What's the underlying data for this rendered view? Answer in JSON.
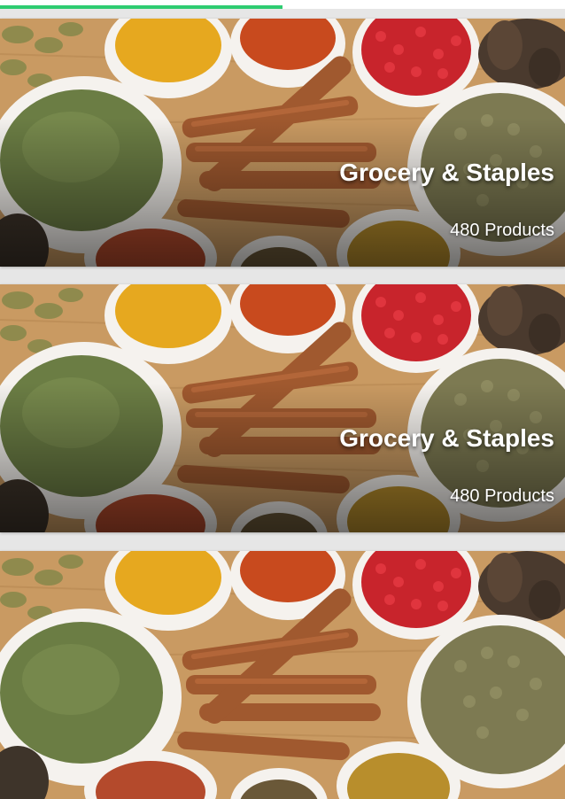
{
  "loading": {
    "progress": 0.5,
    "color": "#2ecc71"
  },
  "categories": [
    {
      "title": "Grocery & Staples",
      "count_label": "480 Products"
    },
    {
      "title": "Grocery & Staples",
      "count_label": "480 Products"
    },
    {
      "title": "",
      "count_label": ""
    }
  ]
}
